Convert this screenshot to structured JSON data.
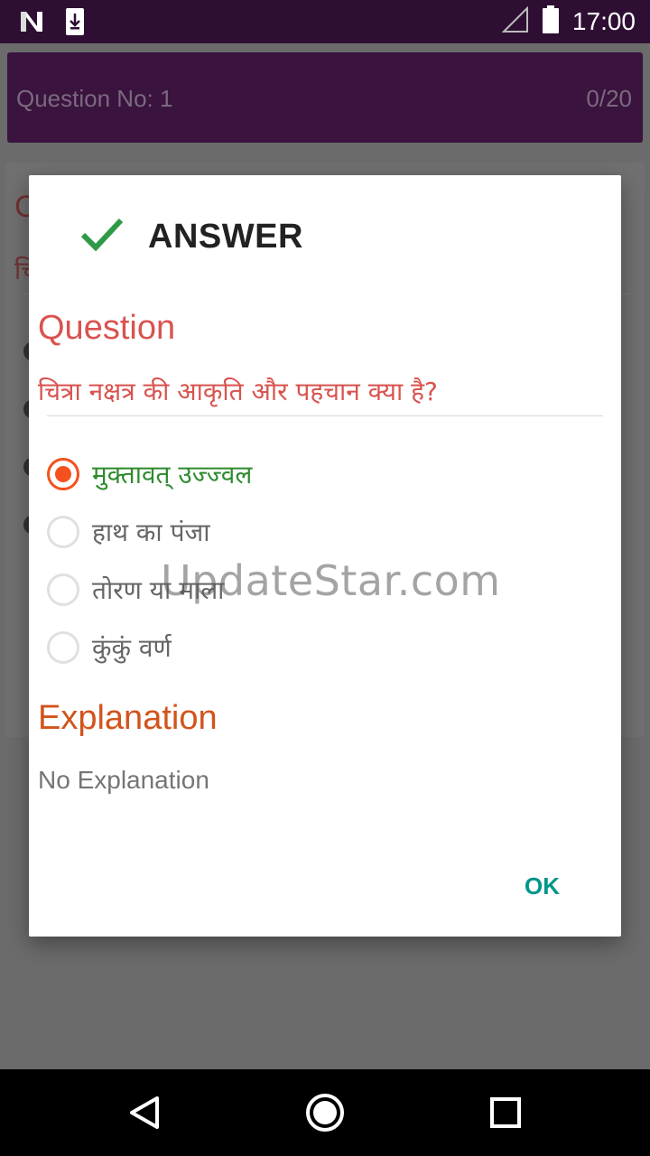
{
  "status_bar": {
    "time": "17:00",
    "icons": [
      "n-logo-icon",
      "download-icon",
      "signal-icon",
      "battery-icon"
    ]
  },
  "app_bar": {
    "question_label": "Question No:  1",
    "progress": "0/20"
  },
  "background": {
    "char1": "C",
    "char2": "चि"
  },
  "dialog": {
    "title": "ANSWER",
    "question_heading": "Question",
    "question_text": "चित्रा नक्षत्र की आकृति और पहचान क्या है?",
    "options": [
      {
        "label": "मुक्तावत् उज्ज्वल",
        "selected": true,
        "correct": true
      },
      {
        "label": "हाथ का पंजा",
        "selected": false,
        "correct": false
      },
      {
        "label": "तोरण या माला",
        "selected": false,
        "correct": false
      },
      {
        "label": "कुंकुं वर्ण",
        "selected": false,
        "correct": false
      }
    ],
    "explanation_heading": "Explanation",
    "explanation_text": "No Explanation",
    "ok_label": "OK"
  },
  "watermark": "UpdateStar.com",
  "colors": {
    "status_bar": "#2e0f33",
    "check": "#2e9a48",
    "question": "#d9534f",
    "explanation": "#d2541c",
    "radio_selected": "#f4511e",
    "correct_answer": "#2e8b2e",
    "ok_button": "#009688"
  }
}
